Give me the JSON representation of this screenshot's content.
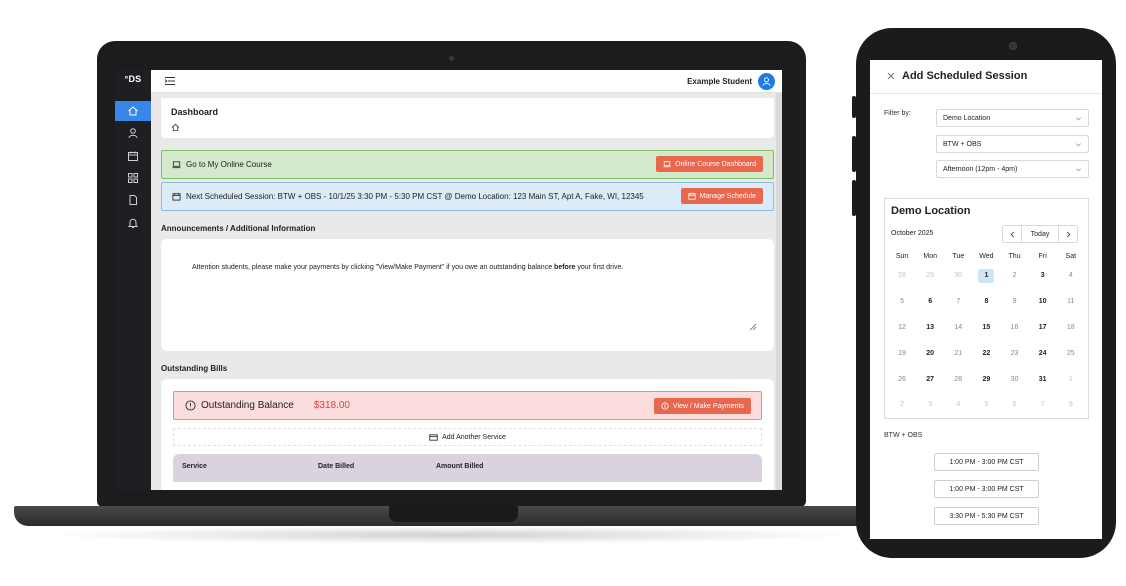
{
  "laptop": {
    "logo": "°DS",
    "user_name": "Example Student",
    "sidebar": [
      "home-icon",
      "user-icon",
      "calendar-icon",
      "grid-icon",
      "document-icon",
      "bell-icon"
    ],
    "page_title": "Dashboard",
    "online_course": {
      "label": "Go to My Online Course",
      "button": "Online Course Dashboard"
    },
    "next_session": {
      "label": "Next Scheduled Session: BTW + OBS - 10/1/25 3:30 PM - 5:30 PM CST @ Demo Location: 123 Main ST, Apt A, Fake, WI, 12345",
      "button": "Manage Schedule"
    },
    "announcements": {
      "heading": "Announcements / Additional Information",
      "text_before": "Attention students, please make your payments by clicking \"View/Make Payment\" if you owe an outstanding balance ",
      "text_bold": "before",
      "text_after": " your first drive."
    },
    "bills": {
      "heading": "Outstanding Bills",
      "balance_label": "Outstanding Balance",
      "balance_amount": "$318.00",
      "pay_button": "View / Make Payments",
      "add_service": "Add Another Service",
      "columns": [
        "Service",
        "Date Billed",
        "Amount Billed"
      ]
    },
    "colors": {
      "accent": "#1e7be6",
      "button_red": "#e8674f",
      "sidebar": "#1d1f23"
    }
  },
  "phone": {
    "title": "Add Scheduled Session",
    "filter_label": "Filter by:",
    "filters": [
      "Demo Location",
      "BTW + OBS",
      "Afternoon (12pm - 4pm)"
    ],
    "calendar": {
      "location": "Demo Location",
      "month": "October 2025",
      "today_button": "Today",
      "weekdays": [
        "Sun",
        "Mon",
        "Tue",
        "Wed",
        "Thu",
        "Fri",
        "Sat"
      ],
      "weeks": [
        [
          "28",
          "29",
          "30",
          "1",
          "2",
          "3",
          "4"
        ],
        [
          "5",
          "6",
          "7",
          "8",
          "9",
          "10",
          "11"
        ],
        [
          "12",
          "13",
          "14",
          "15",
          "16",
          "17",
          "18"
        ],
        [
          "19",
          "20",
          "21",
          "22",
          "23",
          "24",
          "25"
        ],
        [
          "26",
          "27",
          "28",
          "29",
          "30",
          "31",
          "1"
        ],
        [
          "2",
          "3",
          "4",
          "5",
          "6",
          "7",
          "8"
        ]
      ],
      "selected_day": "1"
    },
    "slots_label": "BTW + OBS",
    "slots": [
      "1:00 PM - 3:00 PM CST",
      "1:00 PM - 3:00 PM CST",
      "3:30 PM - 5:30 PM CST"
    ]
  }
}
